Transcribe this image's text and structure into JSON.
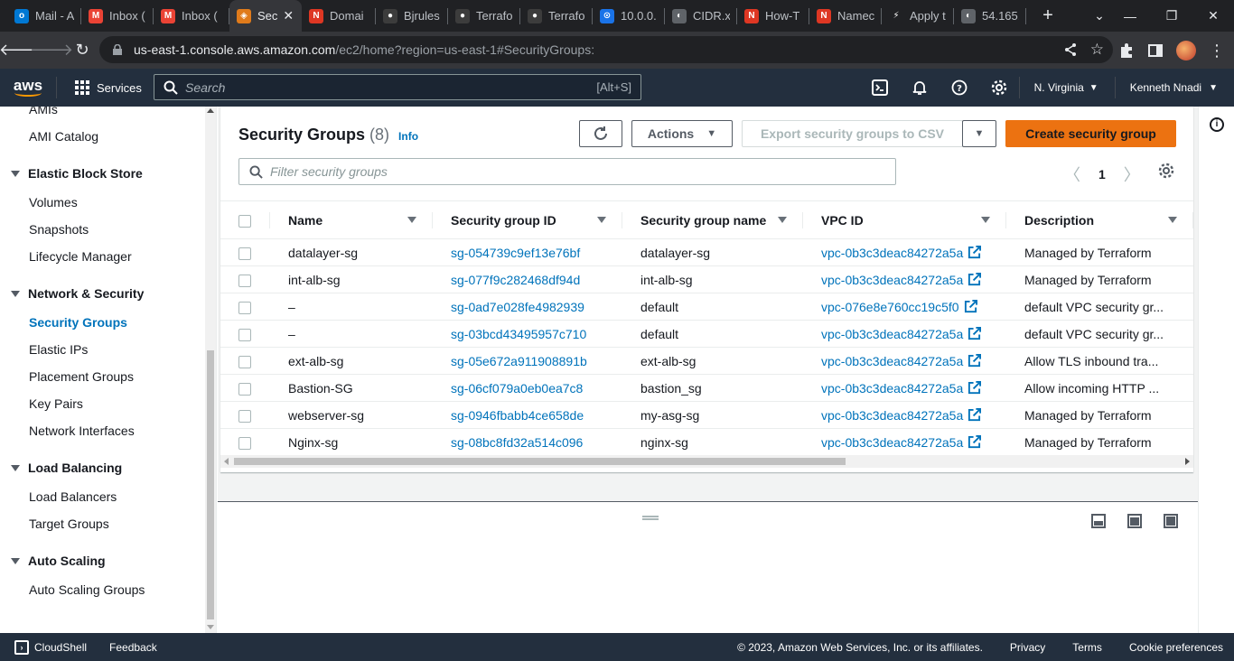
{
  "browser": {
    "tabs": [
      {
        "title": "Mail - A",
        "icon": "outlook-icon",
        "color": "#0078d4",
        "glyph": "o"
      },
      {
        "title": "Inbox (",
        "icon": "gmail-icon",
        "color": "#ea4335",
        "glyph": "M"
      },
      {
        "title": "Inbox (",
        "icon": "gmail-icon",
        "color": "#ea4335",
        "glyph": "M"
      },
      {
        "title": "Sec",
        "icon": "aws-ec2-icon",
        "color": "#e07b1b",
        "glyph": "◈"
      },
      {
        "title": "Domai",
        "icon": "namecheap-icon",
        "color": "#de3723",
        "glyph": "N"
      },
      {
        "title": "Bjrules",
        "icon": "github-icon",
        "color": "#3c3c3c",
        "glyph": "●"
      },
      {
        "title": "Terrafo",
        "icon": "github-icon",
        "color": "#3c3c3c",
        "glyph": "●"
      },
      {
        "title": "Terrafo",
        "icon": "github-icon",
        "color": "#3c3c3c",
        "glyph": "●"
      },
      {
        "title": "10.0.0.",
        "icon": "ip-icon",
        "color": "#1a73e8",
        "glyph": "⊙"
      },
      {
        "title": "CIDR.x",
        "icon": "globe-icon",
        "color": "#5f6368",
        "glyph": "◐"
      },
      {
        "title": "How-T",
        "icon": "namecheap-icon",
        "color": "#de3723",
        "glyph": "N"
      },
      {
        "title": "Namec",
        "icon": "namecheap-icon",
        "color": "#de3723",
        "glyph": "N"
      },
      {
        "title": "Apply t",
        "icon": "zapier-icon",
        "color": "#202124",
        "glyph": "⚡"
      },
      {
        "title": "54.165.",
        "icon": "globe-icon",
        "color": "#5f6368",
        "glyph": "◐"
      }
    ],
    "active_tab_close": "✕",
    "new_tab": "+",
    "url_host": "us-east-1.console.aws.amazon.com",
    "url_path": "/ec2/home?region=us-east-1#SecurityGroups:"
  },
  "awsnav": {
    "logo": "aws",
    "services": "Services",
    "search_placeholder": "Search",
    "search_shortcut": "[Alt+S]",
    "region": "N. Virginia",
    "user": "Kenneth Nnadi"
  },
  "sidebar": {
    "items": [
      {
        "type": "item",
        "label": "AMIs",
        "name": "sidebar-item-amis"
      },
      {
        "type": "item",
        "label": "AMI Catalog",
        "name": "sidebar-item-ami-catalog"
      },
      {
        "type": "head",
        "label": "Elastic Block Store",
        "name": "sidebar-section-ebs"
      },
      {
        "type": "item",
        "label": "Volumes",
        "name": "sidebar-item-volumes"
      },
      {
        "type": "item",
        "label": "Snapshots",
        "name": "sidebar-item-snapshots"
      },
      {
        "type": "item",
        "label": "Lifecycle Manager",
        "name": "sidebar-item-lifecycle-manager"
      },
      {
        "type": "head",
        "label": "Network & Security",
        "name": "sidebar-section-network-security"
      },
      {
        "type": "item",
        "label": "Security Groups",
        "name": "sidebar-item-security-groups",
        "active": true
      },
      {
        "type": "item",
        "label": "Elastic IPs",
        "name": "sidebar-item-elastic-ips"
      },
      {
        "type": "item",
        "label": "Placement Groups",
        "name": "sidebar-item-placement-groups"
      },
      {
        "type": "item",
        "label": "Key Pairs",
        "name": "sidebar-item-key-pairs"
      },
      {
        "type": "item",
        "label": "Network Interfaces",
        "name": "sidebar-item-network-interfaces"
      },
      {
        "type": "head",
        "label": "Load Balancing",
        "name": "sidebar-section-load-balancing"
      },
      {
        "type": "item",
        "label": "Load Balancers",
        "name": "sidebar-item-load-balancers"
      },
      {
        "type": "item",
        "label": "Target Groups",
        "name": "sidebar-item-target-groups"
      },
      {
        "type": "head",
        "label": "Auto Scaling",
        "name": "sidebar-section-auto-scaling"
      },
      {
        "type": "item",
        "label": "Auto Scaling Groups",
        "name": "sidebar-item-auto-scaling-groups"
      }
    ]
  },
  "main": {
    "title": "Security Groups",
    "count": "(8)",
    "info": "Info",
    "actions": "Actions",
    "export": "Export security groups to CSV",
    "create": "Create security group",
    "filter_placeholder": "Filter security groups",
    "page": "1",
    "columns": [
      "Name",
      "Security group ID",
      "Security group name",
      "VPC ID",
      "Description"
    ],
    "rows": [
      [
        "datalayer-sg",
        "sg-054739c9ef13e76bf",
        "datalayer-sg",
        "vpc-0b3c3deac84272a5a",
        "Managed by Terraform"
      ],
      [
        "int-alb-sg",
        "sg-077f9c282468df94d",
        "int-alb-sg",
        "vpc-0b3c3deac84272a5a",
        "Managed by Terraform"
      ],
      [
        "–",
        "sg-0ad7e028fe4982939",
        "default",
        "vpc-076e8e760cc19c5f0",
        "default VPC security gr..."
      ],
      [
        "–",
        "sg-03bcd43495957c710",
        "default",
        "vpc-0b3c3deac84272a5a",
        "default VPC security gr..."
      ],
      [
        "ext-alb-sg",
        "sg-05e672a911908891b",
        "ext-alb-sg",
        "vpc-0b3c3deac84272a5a",
        "Allow TLS inbound tra..."
      ],
      [
        "Bastion-SG",
        "sg-06cf079a0eb0ea7c8",
        "bastion_sg",
        "vpc-0b3c3deac84272a5a",
        "Allow incoming HTTP ..."
      ],
      [
        "webserver-sg",
        "sg-0946fbabb4ce658de",
        "my-asg-sg",
        "vpc-0b3c3deac84272a5a",
        "Managed by Terraform"
      ],
      [
        "Nginx-sg",
        "sg-08bc8fd32a514c096",
        "nginx-sg",
        "vpc-0b3c3deac84272a5a",
        "Managed by Terraform"
      ]
    ]
  },
  "footer": {
    "cloudshell": "CloudShell",
    "feedback": "Feedback",
    "copyright": "© 2023, Amazon Web Services, Inc. or its affiliates.",
    "privacy": "Privacy",
    "terms": "Terms",
    "cookies": "Cookie preferences"
  },
  "colors": {
    "aws_nav": "#232f3e",
    "accent_link": "#0073bb",
    "primary_button": "#ec7211"
  }
}
